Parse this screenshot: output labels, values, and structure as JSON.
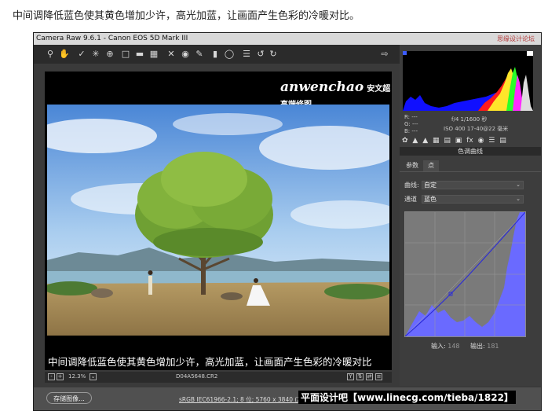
{
  "page_caption": "中间调降低蓝色使其黄色增加少许，高光加蓝，让画面产生色彩的冷暖对比。",
  "window": {
    "title": "Camera Raw 9.6.1 -  Canon EOS 5D Mark III",
    "brand_corner": "思缘设计论坛"
  },
  "toolbar": {
    "icons": [
      "zoom-icon",
      "hand-icon",
      "white-balance-icon",
      "color-sampler-icon",
      "target-adjust-icon",
      "crop-icon",
      "straighten-icon",
      "transform-icon",
      "spot-removal-icon",
      "red-eye-icon",
      "adjustment-brush-icon",
      "graduated-filter-icon",
      "radial-filter-icon",
      "preferences-icon",
      "rotate-ccw-icon",
      "rotate-cw-icon"
    ],
    "open_icon": "open-in-photoshop-icon"
  },
  "preview": {
    "logo": {
      "main": "anwenchao",
      "cn": "安文超 高端修图",
      "sub": "AN WENCHAO HIGH-END GRAPHIC OFFICIAL WEBSITE WWW.ANWENCHAO.COM"
    },
    "caption": "中间调降低蓝色使其黄色增加少许，高光加蓝，让画面产生色彩的冷暖对比"
  },
  "statusbar": {
    "zoom": "12.3%",
    "filename": "D04A5648.CR2"
  },
  "bottombar": {
    "save_label": "存储图像...",
    "workflow": "sRGB IEC61966-2.1; 8 位; 5760 x 3840 (22.1MP); 300 ppi",
    "watermark": "平面设计吧【www.linecg.com/tieba/1822】"
  },
  "readout": {
    "r": "R:  ---",
    "g": "G:  ---",
    "b": "B:  ---",
    "aperture_shutter": "f/4   1/1600 秒",
    "iso_lens": "ISO 400   17-40@22 毫米"
  },
  "panel": {
    "title": "色调曲线",
    "tab_params": "参数",
    "tab_point": "点",
    "curve_label": "曲线:",
    "curve_value": "自定",
    "channel_label": "通道",
    "channel_value": "蓝色",
    "input_label": "输入:",
    "input_value": "148",
    "output_label": "输出:",
    "output_value": "181"
  },
  "colors": {
    "blue_channel": "#6a6aff",
    "curve_line": "#2a2ad8"
  }
}
